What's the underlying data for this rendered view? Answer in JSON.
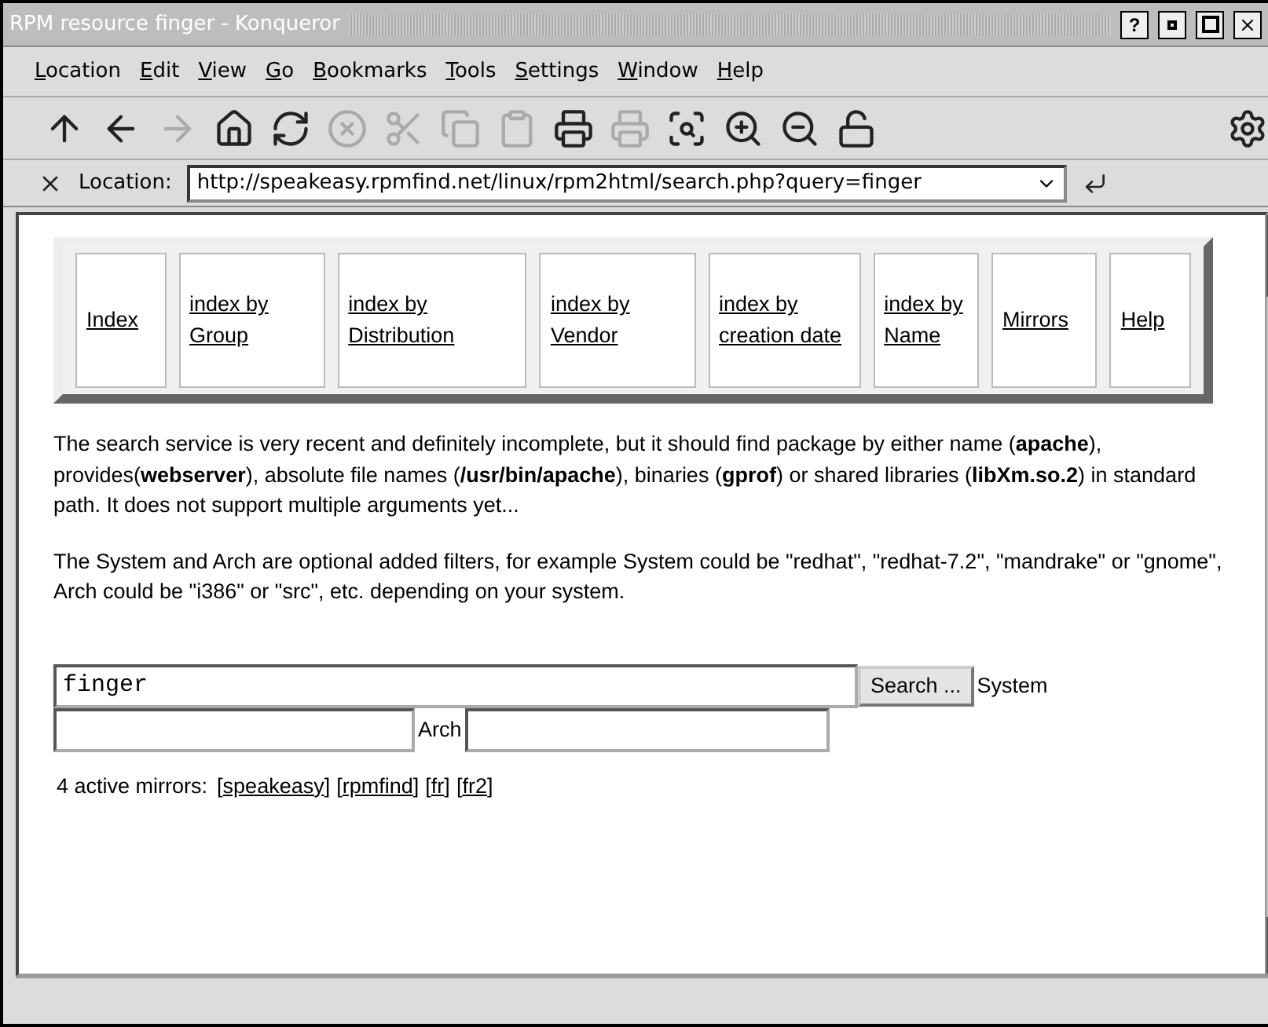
{
  "window": {
    "title": "RPM resource finger - Konqueror",
    "buttons": [
      "?"
    ]
  },
  "menu": [
    "Location",
    "Edit",
    "View",
    "Go",
    "Bookmarks",
    "Tools",
    "Settings",
    "Window",
    "Help"
  ],
  "toolbar": [
    {
      "kind": "up",
      "disabled": false
    },
    {
      "kind": "back",
      "disabled": false
    },
    {
      "kind": "forward",
      "disabled": true
    },
    {
      "kind": "home",
      "disabled": false
    },
    {
      "kind": "reload",
      "disabled": false
    },
    {
      "kind": "stop",
      "disabled": true
    },
    {
      "kind": "cut",
      "disabled": true
    },
    {
      "kind": "copy",
      "disabled": true
    },
    {
      "kind": "paste",
      "disabled": true
    },
    {
      "kind": "print",
      "disabled": false
    },
    {
      "kind": "printpreview",
      "disabled": true
    },
    {
      "kind": "find",
      "disabled": false
    },
    {
      "kind": "zoomin",
      "disabled": false
    },
    {
      "kind": "zoomout",
      "disabled": false
    },
    {
      "kind": "lock",
      "disabled": false
    }
  ],
  "location": {
    "label": "Location:",
    "url": "http://speakeasy.rpmfind.net/linux/rpm2html/search.php?query=finger"
  },
  "nav": [
    "Index",
    "index by Group",
    "index by Distribution",
    "index by Vendor",
    "index by creation date",
    "index by Name",
    "Mirrors",
    "Help"
  ],
  "paragraphs": [
    "The search service is very recent and definitely incomplete, but it should find package by either name (**apache**), provides(**webserver**), absolute file names (**/usr/bin/apache**), binaries (**gprof**) or shared libraries (**libXm.so.2**) in standard path. It does not support multiple arguments yet...",
    "The System and Arch are optional added filters, for example System could be \"redhat\", \"redhat-7.2\", \"mandrake\" or \"gnome\", Arch could be \"i386\" or \"src\", etc. depending on your system."
  ],
  "form": {
    "query": "finger",
    "button": "Search ...",
    "system_label": "System",
    "arch_label": "Arch"
  },
  "mirrors": {
    "label": "4 active mirrors:",
    "links": [
      {
        "before": "[",
        "text": "speakeasy",
        "after": "]"
      },
      {
        "before": "[",
        "text": "rpmfind",
        "after": "]"
      },
      {
        "before": "[",
        "text": "fr",
        "after": "]"
      },
      {
        "before": "[",
        "text": "fr2",
        "after": "]"
      }
    ]
  }
}
